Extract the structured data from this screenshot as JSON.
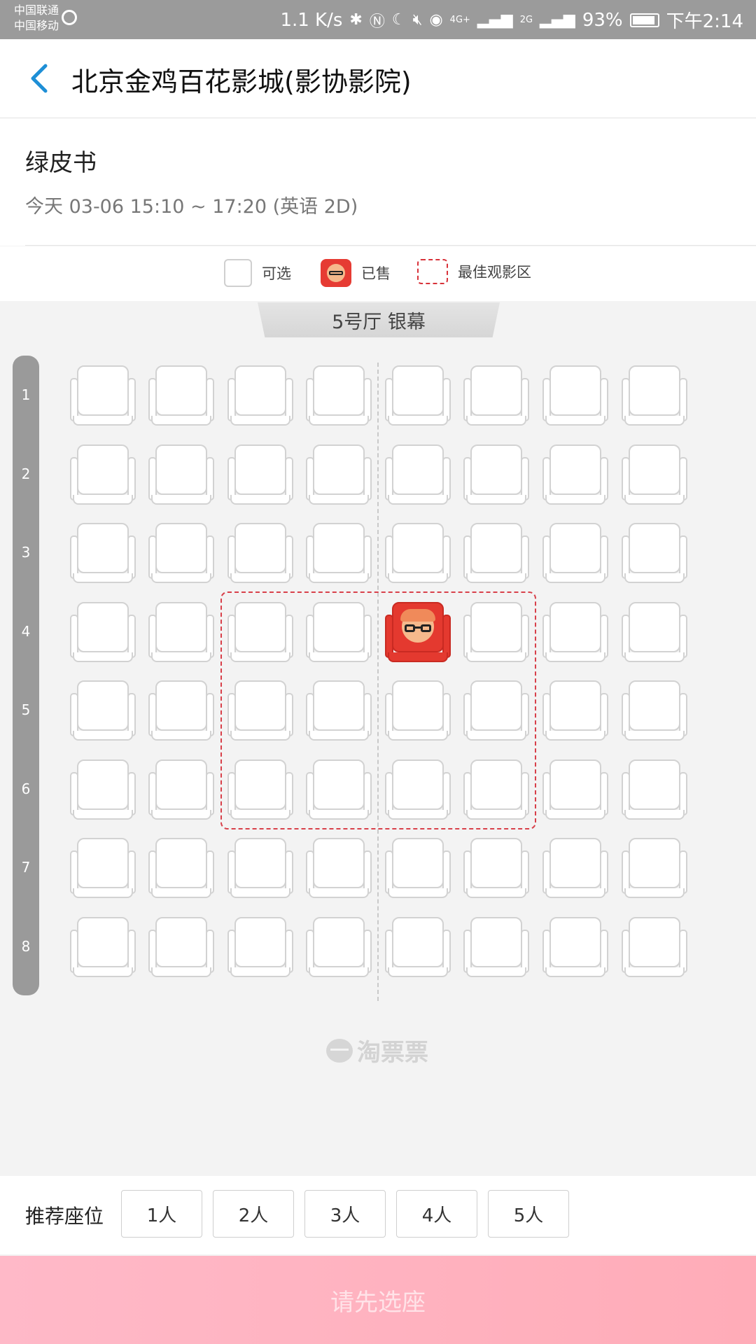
{
  "status_bar": {
    "carrier_1": "中国联通",
    "carrier_2": "中国移动",
    "net_speed": "1.1 K/s",
    "network_4g": "4G+",
    "network_2g": "2G",
    "battery": "93%",
    "battery_level": 93,
    "time": "下午2:14"
  },
  "header": {
    "back_icon": "chevron-left-icon",
    "title": "北京金鸡百花影城(影协影院)"
  },
  "movie": {
    "name": "绿皮书",
    "showtime": "今天 03-06 15:10 ~ 17:20 (英语 2D)"
  },
  "legend": {
    "available": "可选",
    "sold": "已售",
    "best_zone": "最佳观影区"
  },
  "hall": {
    "screen_label": "5号厅 银幕"
  },
  "seat_map": {
    "rows": [
      "1",
      "2",
      "3",
      "4",
      "5",
      "6",
      "7",
      "8"
    ],
    "columns": 8,
    "sold": [
      {
        "row": 4,
        "col": 5
      }
    ],
    "best_zone": {
      "rows": [
        4,
        6
      ],
      "cols": [
        3,
        6
      ]
    }
  },
  "watermark": "淘票票",
  "recommend": {
    "label": "推荐座位",
    "options": [
      "1人",
      "2人",
      "3人",
      "4人",
      "5人"
    ]
  },
  "confirm_button": "请先选座",
  "colors": {
    "accent_blue": "#1e8fd6",
    "sold_red": "#e4392f",
    "best_zone_red": "#d8404a",
    "confirm_pink": "#ffb3c1"
  }
}
